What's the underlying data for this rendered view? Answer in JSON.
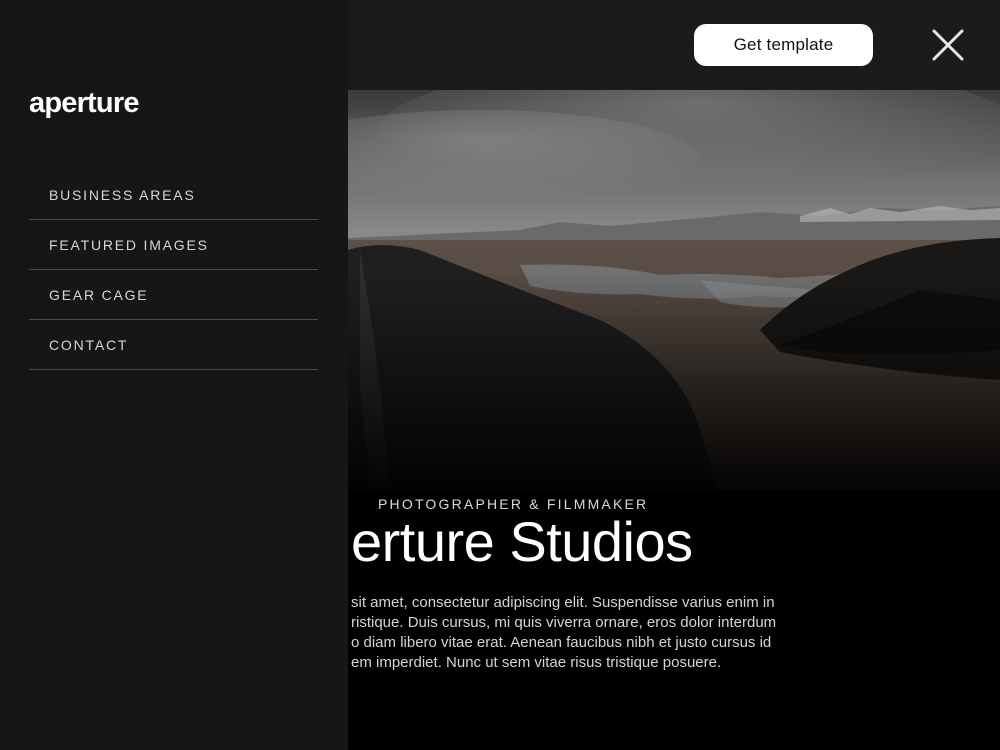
{
  "header": {
    "cta_label": "Get template",
    "close_icon": "close-icon"
  },
  "sidebar": {
    "logo_text": "aperture",
    "items": [
      {
        "label": "BUSINESS AREAS"
      },
      {
        "label": "FEATURED IMAGES"
      },
      {
        "label": "GEAR CAGE"
      },
      {
        "label": "CONTACT"
      }
    ]
  },
  "hero": {
    "eyebrow": "PHOTOGRAPHER & FILMMAKER",
    "title": "erture Studios",
    "body_lines": [
      "sit amet, consectetur adipiscing elit. Suspendisse varius enim in",
      "ristique. Duis cursus, mi quis viverra ornare, eros dolor interdum",
      "o diam libero vitae erat. Aenean faucibus nibh et justo cursus id",
      "em imperdiet. Nunc ut sem vitae risus tristique posuere."
    ]
  },
  "colors": {
    "drawer_bg": "#161617",
    "topbar_bg": "#1b1b1c",
    "accent_button": "#ffffff",
    "divider": "#4a4a4c"
  }
}
